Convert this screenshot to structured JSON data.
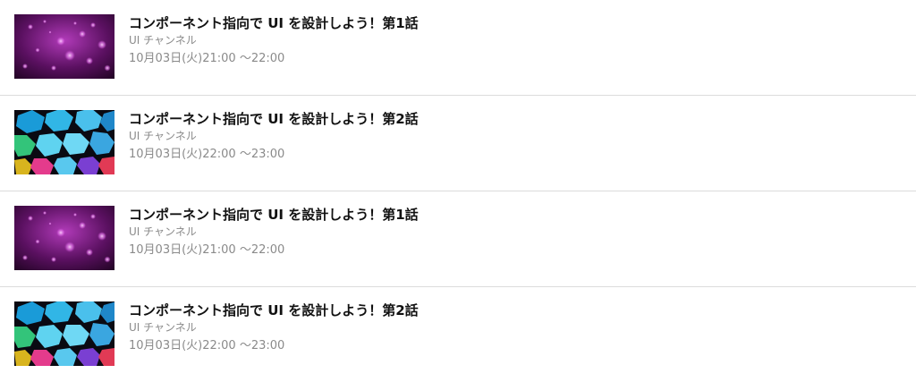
{
  "programs": [
    {
      "title": "コンポーネント指向で UI を設計しよう！第1話",
      "channel": "UI チャンネル",
      "time": "10月03日(火)21:00 〜22:00",
      "thumbnail": "bokeh-purple-image"
    },
    {
      "title": "コンポーネント指向で UI を設計しよう！第2話",
      "channel": "UI チャンネル",
      "time": "10月03日(火)22:00 〜23:00",
      "thumbnail": "hexagon-colorful-image"
    },
    {
      "title": "コンポーネント指向で UI を設計しよう！第1話",
      "channel": "UI チャンネル",
      "time": "10月03日(火)21:00 〜22:00",
      "thumbnail": "bokeh-purple-image"
    },
    {
      "title": "コンポーネント指向で UI を設計しよう！第2話",
      "channel": "UI チャンネル",
      "time": "10月03日(火)22:00 〜23:00",
      "thumbnail": "hexagon-colorful-image"
    }
  ]
}
